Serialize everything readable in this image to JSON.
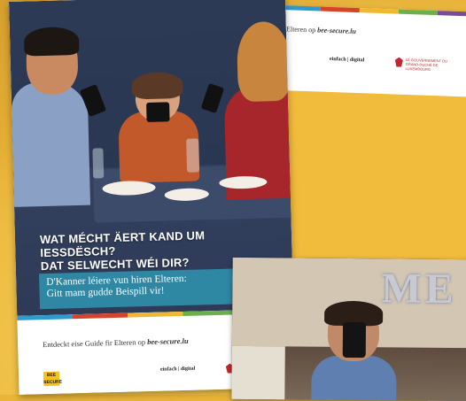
{
  "colors": {
    "background": "#e9b437",
    "teal": "#2e87a3",
    "stripe": [
      "#2e9ad0",
      "#d6432b",
      "#f2b731",
      "#6bb04a",
      "#7d4a9a"
    ]
  },
  "back_poster": {
    "guide_prefix": "Elteren op ",
    "guide_site": "bee-secure.lu",
    "partner_logo": "einfach | digital",
    "lux_logo_text": "LE GOUVERNEMENT DU GRAND-DUCHÉ DE LUXEMBOURG"
  },
  "front_poster": {
    "headline_line1": "WAT MÉCHT ÄERT KAND UM IESSDËSCH?",
    "headline_line2": "DAT SELWECHT WÉI DIR?",
    "subtitle_line1": "D'Kanner léiere vun hiren Elteren:",
    "subtitle_line2": "Gitt mam gudde Beispill vir!",
    "guide_prefix": "Entdeckt eise Guide fir Elteren op ",
    "guide_site": "bee-secure.lu",
    "bee_logo": "BEE SECURE",
    "partner_logo": "einfach | digital"
  },
  "photo2": {
    "wall_letters": "ME"
  }
}
